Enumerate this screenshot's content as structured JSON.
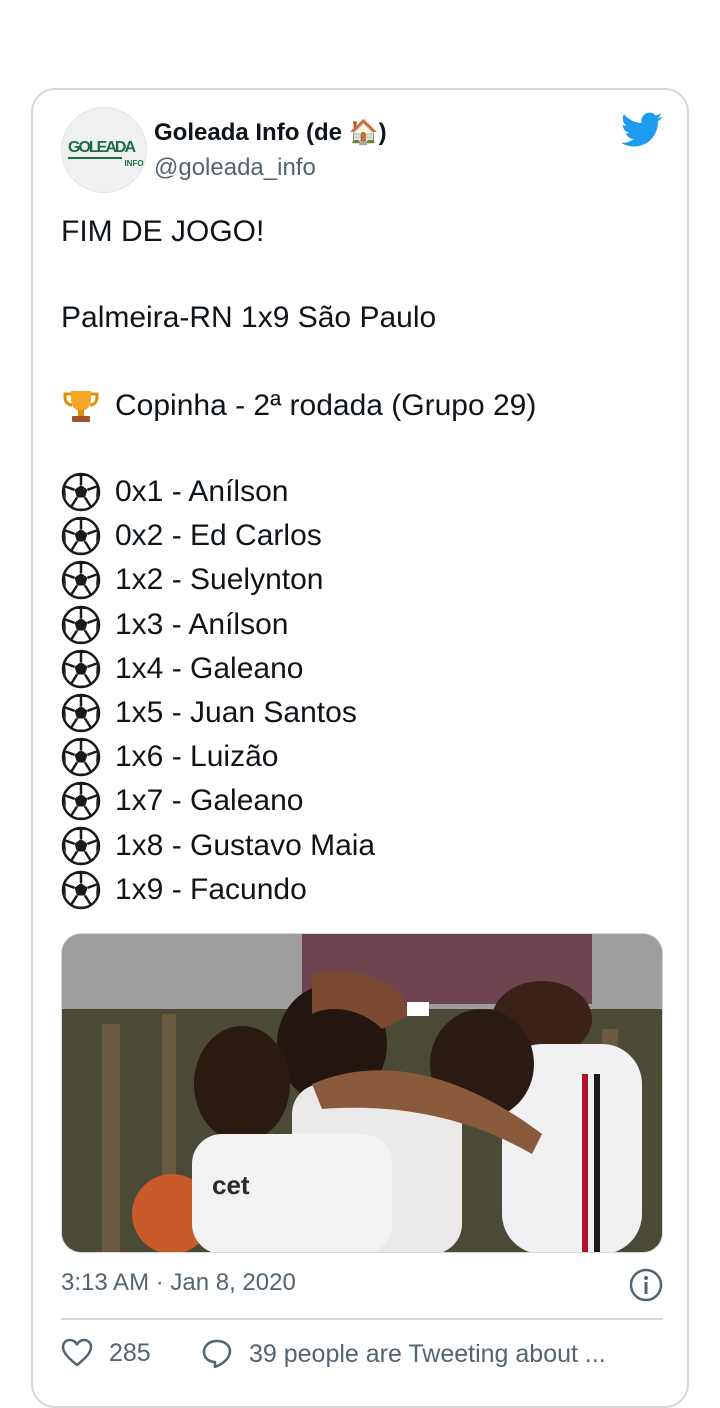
{
  "tweet": {
    "author": {
      "display_name": "Goleada Info (de 🏠)",
      "handle": "@goleada_info",
      "avatar_text_main": "GOLEADA",
      "avatar_text_sub": "INFO"
    },
    "lines": {
      "headline": "FIM DE JOGO!",
      "score": "Palmeira-RN 1x9 São Paulo",
      "competition": "Copinha - 2ª rodada (Grupo 29)"
    },
    "goals": [
      "0x1 - Anílson",
      "0x2 - Ed Carlos",
      "1x2 - Suelynton",
      "1x3 - Anílson",
      "1x4 - Galeano",
      "1x5 - Juan Santos",
      "1x6 - Luizão",
      "1x7 - Galeano",
      "1x8 - Gustavo Maia",
      "1x9 - Facundo"
    ],
    "timestamp": "3:13 AM · Jan 8, 2020",
    "likes": "285",
    "conversation": "39 people are Tweeting about ..."
  },
  "icons": {
    "brand": "twitter-bird-icon",
    "trophy": "trophy-icon",
    "ball": "soccer-ball-icon",
    "info": "info-icon",
    "like": "heart-icon",
    "reply": "speech-bubble-icon"
  },
  "colors": {
    "twitter_blue": "#1d9bf0",
    "text": "#0f1419",
    "secondary_text": "#536471",
    "border": "#cfd9de",
    "avatar_green": "#1f6b45"
  }
}
